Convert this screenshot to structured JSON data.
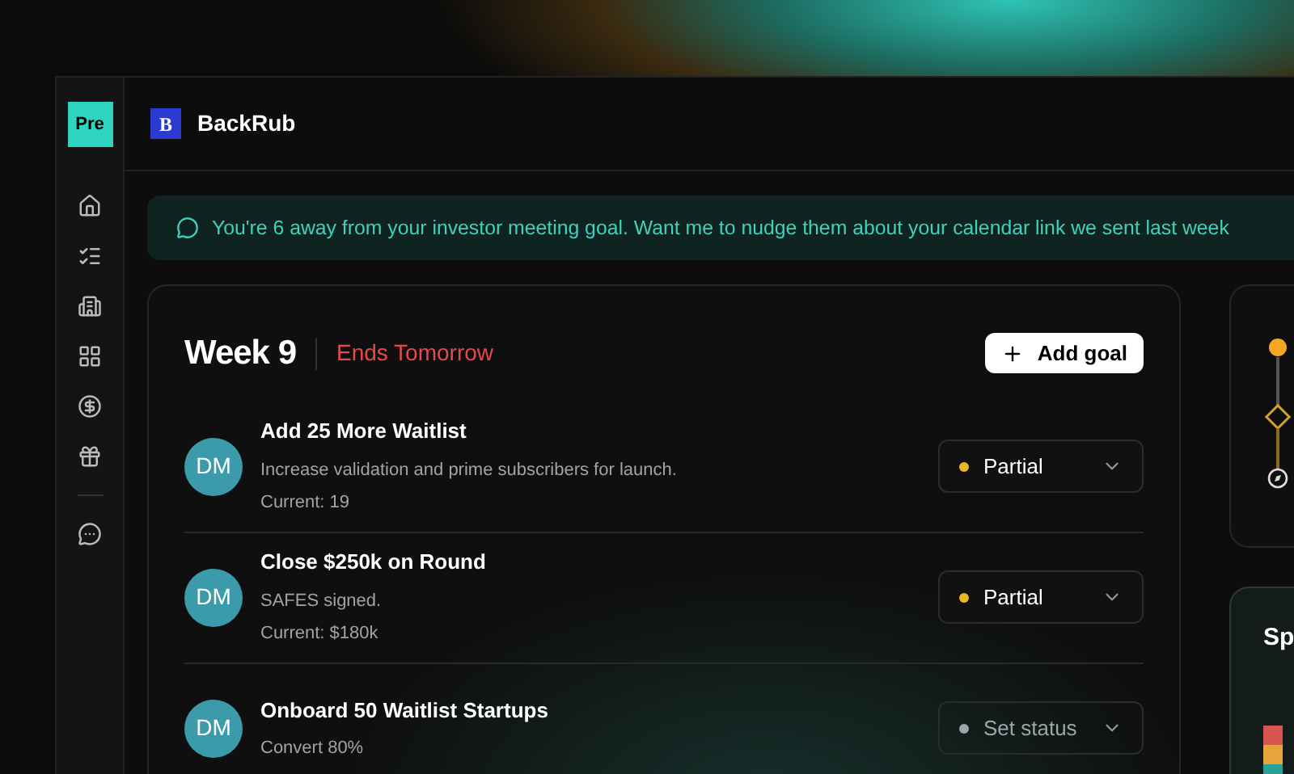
{
  "sidebar": {
    "logo": "Pre"
  },
  "header": {
    "brand_mark": "B",
    "title": "BackRub"
  },
  "banner": {
    "text": "You're 6 away from your investor meeting goal. Want me to nudge them about your calendar link we sent last week"
  },
  "week": {
    "title": "Week 9",
    "deadline": "Ends Tomorrow",
    "add_button": "Add goal"
  },
  "goals": [
    {
      "avatar": "DM",
      "title": "Add 25 More Waitlist",
      "lines": [
        "Increase validation and prime subscribers for launch.",
        "Current: 19"
      ],
      "status": {
        "kind": "value",
        "label": "Partial",
        "color": "#e8b923"
      }
    },
    {
      "avatar": "DM",
      "title": "Close $250k on Round",
      "lines": [
        "SAFES signed.",
        "Current: $180k"
      ],
      "status": {
        "kind": "value",
        "label": "Partial",
        "color": "#e8b923"
      }
    },
    {
      "avatar": "DM",
      "title": "Onboard 50 Waitlist Startups",
      "lines": [
        "Convert 80%"
      ],
      "status": {
        "kind": "placeholder",
        "label": "Set status",
        "color": "#9aa7a6"
      }
    }
  ],
  "side_card": {
    "title": "Sp"
  }
}
